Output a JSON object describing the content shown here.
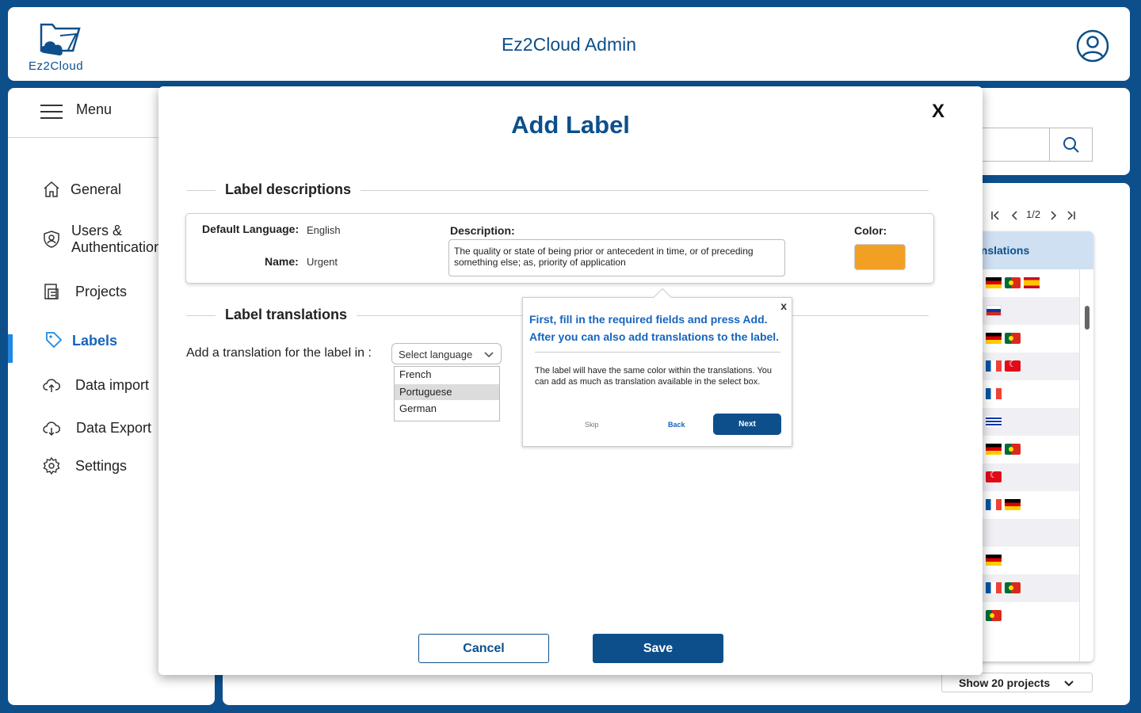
{
  "header": {
    "app_title": "Ez2Cloud Admin",
    "logo_text": "Ez2Cloud"
  },
  "sidebar": {
    "menu_label": "Menu",
    "items": [
      {
        "label": "General",
        "icon": "home-icon"
      },
      {
        "label": "Users &",
        "label2": "Authentication",
        "icon": "shield-user-icon"
      },
      {
        "label": "Projects",
        "icon": "projects-icon"
      },
      {
        "label": "Labels",
        "icon": "tag-icon",
        "active": true
      },
      {
        "label": "Data import",
        "icon": "cloud-upload-icon"
      },
      {
        "label": "Data Export",
        "icon": "cloud-download-icon"
      },
      {
        "label": "Settings",
        "icon": "gear-icon"
      }
    ]
  },
  "background": {
    "pagination": "1/2",
    "table_header": "anslations",
    "show_select": "Show 20 projects"
  },
  "modal": {
    "title": "Add Label",
    "close": "X",
    "descriptions_title": "Label descriptions",
    "default_language_label": "Default Language:",
    "default_language_value": "English",
    "name_label": "Name:",
    "name_value": "Urgent",
    "description_label": "Description:",
    "description_value": "The quality or state of being prior or antecedent in time, or of preceding something else; as, priority of application",
    "color_label": "Color:",
    "color_value": "#f2a024",
    "translations_title": "Label translations",
    "translation_prompt": "Add a translation for the label in :",
    "select_placeholder": "Select language",
    "language_options": [
      "French",
      "Portuguese",
      "German"
    ],
    "highlighted_option": "Portuguese",
    "cancel_label": "Cancel",
    "save_label": "Save"
  },
  "tooltip": {
    "close": "x",
    "heading_line1": "First, fill in the required fields and press Add.",
    "heading_line2": "After you can also add translations to the label.",
    "body": "The label will have the same color within the translations. You can add as much as translation available in the select box.",
    "skip_label": "Skip",
    "back_label": "Back",
    "next_label": "Next"
  },
  "colors": {
    "brand": "#0d4f8b",
    "accent": "#1e88e5",
    "label_color": "#f2a024"
  }
}
